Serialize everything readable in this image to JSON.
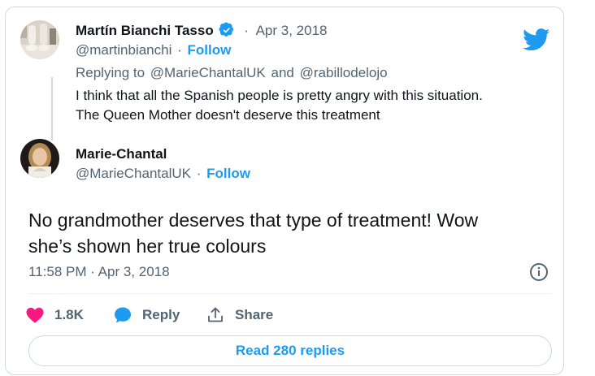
{
  "reply_tweet": {
    "author_name": "Martín Bianchi Tasso",
    "separator": "·",
    "date": "Apr 3, 2018",
    "handle": "@martinbianchi",
    "follow_label": "Follow",
    "replying_prefix": "Replying to",
    "replying_to_1": "@MarieChantalUK",
    "replying_and": "and",
    "replying_to_2": "@rabillodelojo",
    "text_line1": "I think that all the Spanish people is pretty angry with this situation.",
    "text_line2": "The Queen Mother doesn't deserve this treatment"
  },
  "main_tweet": {
    "author_name": "Marie-Chantal",
    "handle": "@MarieChantalUK",
    "separator": "·",
    "follow_label": "Follow",
    "text_line1": "No grandmother deserves that type of treatment! Wow",
    "text_line2": "she’s shown her true colours",
    "timestamp": "11:58 PM · Apr 3, 2018"
  },
  "actions": {
    "likes": "1.8K",
    "reply_label": "Reply",
    "share_label": "Share"
  },
  "read_replies_label": "Read 280 replies",
  "icons": {
    "brand": "twitter-bird-icon",
    "verified": "verified-badge-icon",
    "like": "heart-icon",
    "reply": "speech-bubble-icon",
    "share": "share-icon",
    "info": "info-icon"
  },
  "colors": {
    "accent": "#1d9bf0",
    "like": "#f91880",
    "muted": "#536471",
    "border": "#cfd9de"
  }
}
